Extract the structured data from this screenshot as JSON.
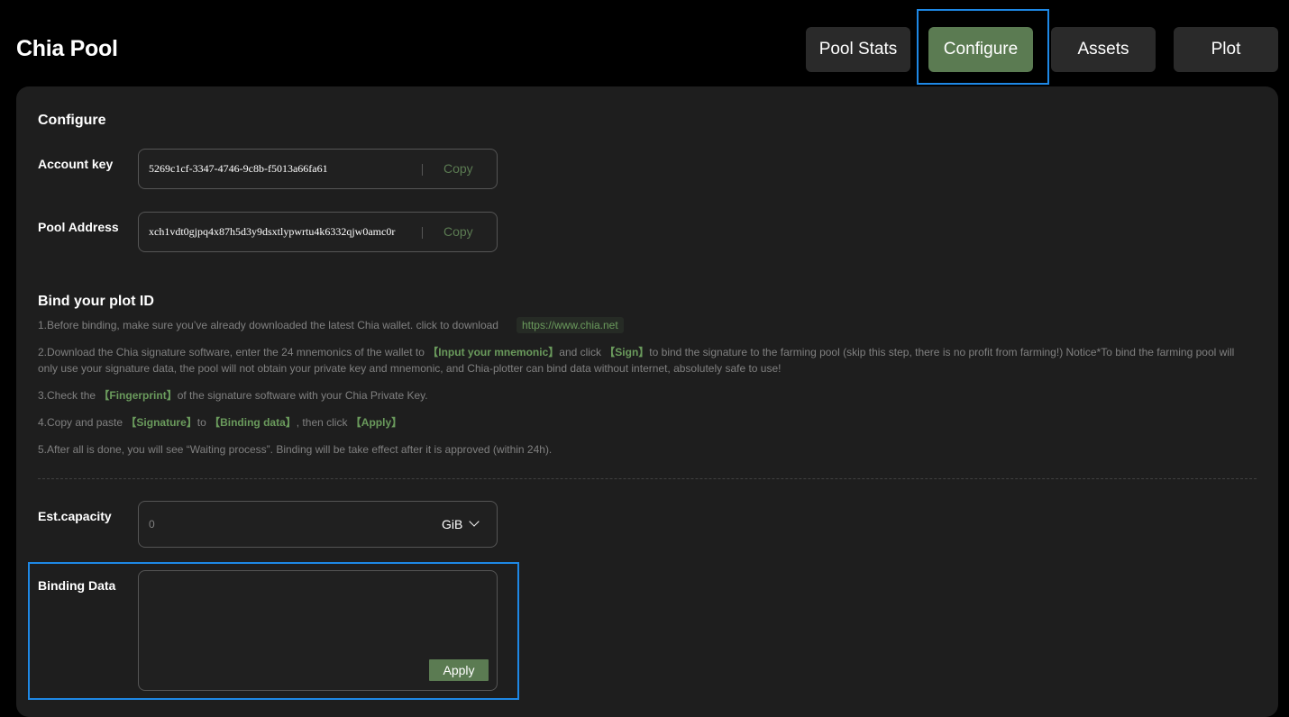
{
  "header": {
    "title": "Chia Pool",
    "nav": [
      {
        "label": "Pool Stats",
        "active": false
      },
      {
        "label": "Configure",
        "active": true
      },
      {
        "label": "Assets",
        "active": false
      },
      {
        "label": "Plot",
        "active": false
      }
    ]
  },
  "configure": {
    "title": "Configure",
    "account_key": {
      "label": "Account key",
      "value": "5269c1cf-3347-4746-9c8b-f5013a66fa61",
      "copy_label": "Copy"
    },
    "pool_address": {
      "label": "Pool Address",
      "value": "xch1vdt0gjpq4x87h5d3y9dsxtlypwrtu4k6332qjw0amc0r",
      "copy_label": "Copy"
    }
  },
  "bind": {
    "title": "Bind your plot ID",
    "step1_text": "1.Before binding, make sure you’ve already downloaded the latest Chia wallet. click to download",
    "step1_url": "https://www.chia.net",
    "step2_a": "2.Download the Chia signature software, enter the 24 mnemonics of the wallet to ",
    "step2_hl1": "【Input your mnemonic】",
    "step2_b": "and click ",
    "step2_hl2": "【Sign】",
    "step2_c": "to bind the signature to the farming pool (skip this step, there is no profit from farming!) Notice*To bind the farming pool will only use your signature data, the pool will not obtain your private key and mnemonic, and Chia-plotter can bind data without internet, absolutely safe to use!",
    "step3_a": "3.Check the ",
    "step3_hl": "【Fingerprint】",
    "step3_b": "of the signature software with your Chia Private Key.",
    "step4_a": "4.Copy and paste ",
    "step4_hl1": "【Signature】",
    "step4_b": "to ",
    "step4_hl2": "【Binding data】",
    "step4_c": ", then click ",
    "step4_hl3": "【Apply】",
    "step5": "5.After all is done, you will see “Waiting process”. Binding will be take effect after it is approved (within 24h)."
  },
  "capacity": {
    "label": "Est.capacity",
    "value": "0",
    "unit": "GiB"
  },
  "binding": {
    "label": "Binding Data",
    "value": "",
    "apply_label": "Apply"
  },
  "colors": {
    "accent": "#5b7b52",
    "highlight_border": "#1e88e5",
    "panel_bg": "#1e1e1e",
    "page_bg": "#000000"
  }
}
